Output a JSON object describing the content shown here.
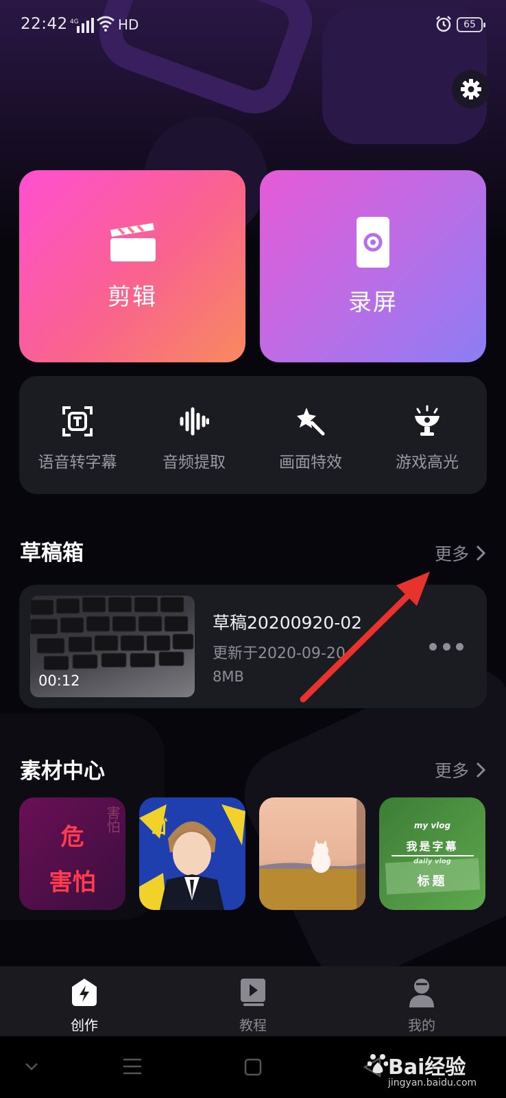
{
  "status_bar": {
    "time": "22:42",
    "network": "4G",
    "hd": "HD",
    "battery": "65"
  },
  "header": {
    "settings_icon": "gear-icon"
  },
  "main_actions": [
    {
      "label": "剪辑",
      "icon": "clapperboard-icon"
    },
    {
      "label": "录屏",
      "icon": "screen-record-icon"
    }
  ],
  "tools": [
    {
      "label": "语音转字幕",
      "icon": "text-recognition-icon"
    },
    {
      "label": "音频提取",
      "icon": "audio-wave-icon"
    },
    {
      "label": "画面特效",
      "icon": "magic-wand-icon"
    },
    {
      "label": "游戏高光",
      "icon": "trophy-icon"
    }
  ],
  "drafts": {
    "title": "草稿箱",
    "more": "更多",
    "items": [
      {
        "name": "草稿20200920-02",
        "updated": "更新于2020-09-20",
        "size": "8MB",
        "duration": "00:12"
      }
    ]
  },
  "materials": {
    "title": "素材中心",
    "more": "更多",
    "items": [
      {
        "text_line1": "危",
        "text_line2": "害怕",
        "side_text": "害怕",
        "colors": [
          "#6b0f55",
          "#3a0f3e"
        ]
      },
      {
        "text": "ゴ",
        "colors": [
          "#1f3fae",
          "#f0d22a"
        ]
      },
      {
        "colors": [
          "#f2c2a6",
          "#b78a3c"
        ]
      },
      {
        "text_small1": "my vlog",
        "text_main": "我是字幕",
        "text_small2": "daily vlog",
        "text_title": "标题",
        "colors": [
          "#3d7d36",
          "#5ea84e"
        ]
      }
    ]
  },
  "tab_bar": [
    {
      "label": "创作",
      "icon": "lightning-icon",
      "active": true
    },
    {
      "label": "教程",
      "icon": "video-book-icon",
      "active": false
    },
    {
      "label": "我的",
      "icon": "user-icon",
      "active": false
    }
  ],
  "watermark": {
    "brand": "Bai经验",
    "url": "jingyan.baidu.com"
  },
  "colors": {
    "accent_red": "#e8322e",
    "tab_active": "#ffffff",
    "tab_inactive": "#8a8891"
  }
}
